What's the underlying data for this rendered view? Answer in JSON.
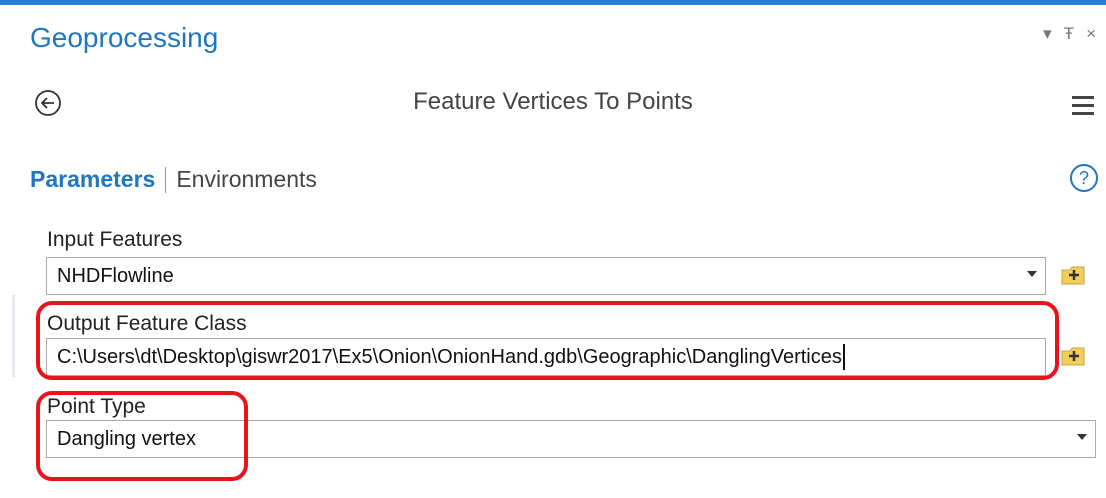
{
  "pane": {
    "title": "Geoprocessing"
  },
  "window_controls": {
    "dropdown": "▾",
    "pin": "Ŧ",
    "close": "×"
  },
  "tool": {
    "title": "Feature Vertices To Points"
  },
  "tabs": {
    "parameters": "Parameters",
    "environments": "Environments"
  },
  "params": {
    "input_features": {
      "label": "Input Features",
      "value": "NHDFlowline"
    },
    "output_feature_class": {
      "label": "Output Feature Class",
      "value": "C:\\Users\\dt\\Desktop\\giswr2017\\Ex5\\Onion\\OnionHand.gdb\\Geographic\\DanglingVertices"
    },
    "point_type": {
      "label": "Point Type",
      "value": "Dangling vertex"
    }
  },
  "colors": {
    "accent": "#1f76c2",
    "highlight": "#e8141c",
    "folder": "#f2cf5b"
  }
}
